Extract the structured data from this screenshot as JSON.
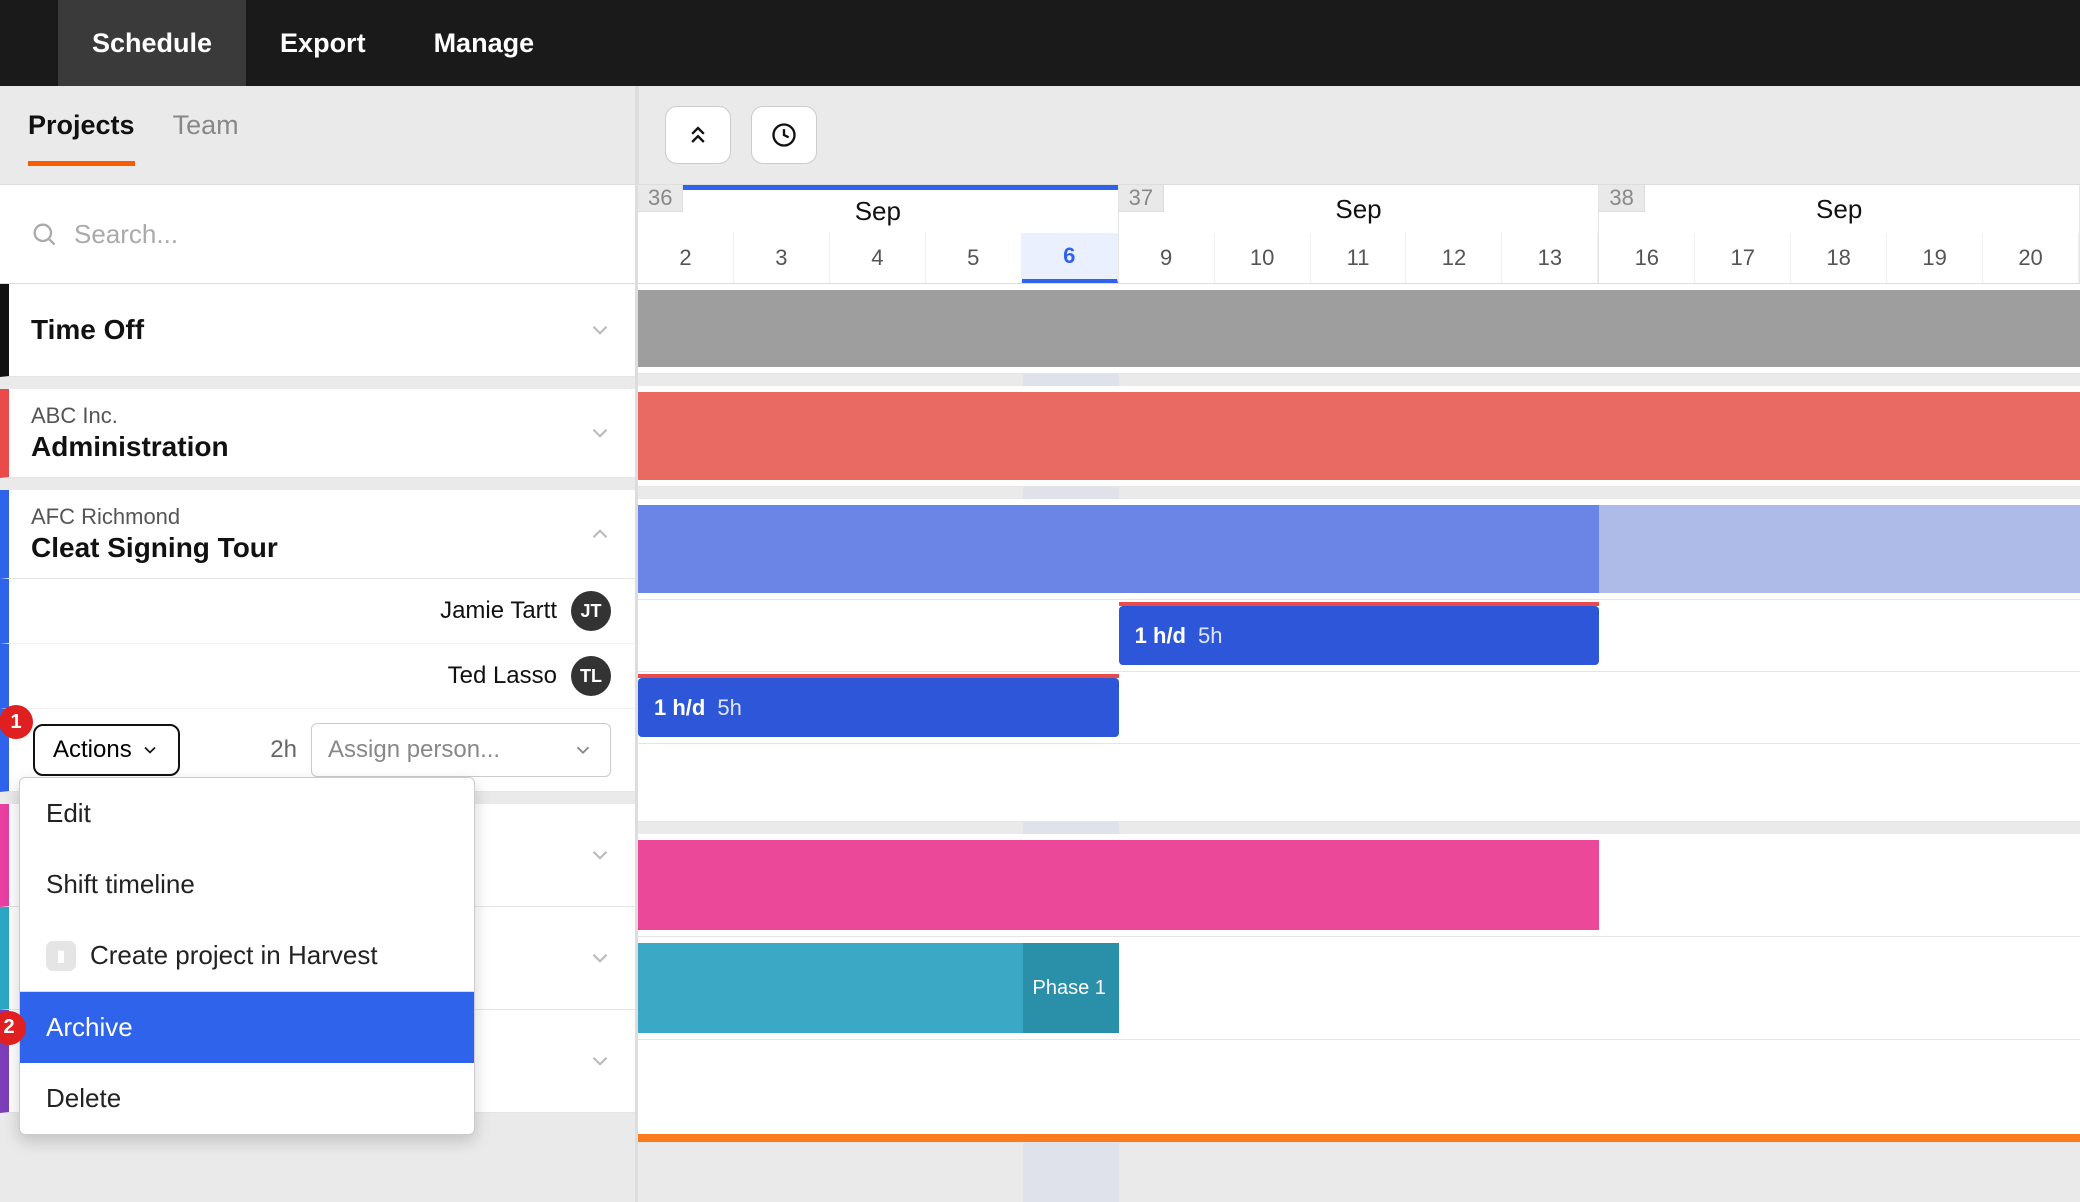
{
  "nav": {
    "tabs": [
      "Schedule",
      "Export",
      "Manage"
    ],
    "active": 0
  },
  "side": {
    "tabs": [
      "Projects",
      "Team"
    ],
    "active": 0,
    "search_placeholder": "Search..."
  },
  "calendar": {
    "weeks": [
      {
        "num": "36",
        "month": "Sep",
        "days": [
          "2",
          "3",
          "4",
          "5",
          "6"
        ],
        "today_index": 4
      },
      {
        "num": "37",
        "month": "Sep",
        "days": [
          "9",
          "10",
          "11",
          "12",
          "13"
        ]
      },
      {
        "num": "38",
        "month": "Sep",
        "days": [
          "16",
          "17",
          "18",
          "19",
          "20"
        ]
      }
    ]
  },
  "projects": [
    {
      "name": "Time Off",
      "client": "",
      "color": "#111",
      "bar_color": "#9e9e9e",
      "bar_start": 0,
      "bar_span": 15
    },
    {
      "name": "Administration",
      "client": "ABC Inc.",
      "color": "#e94b4b",
      "bar_color": "#e86a63",
      "bar_start": 0,
      "bar_span": 15
    },
    {
      "name": "Cleat Signing Tour",
      "client": "AFC Richmond",
      "color": "#2f63eb",
      "expanded": true,
      "bars": [
        {
          "color": "#6b85e6",
          "start": 0,
          "span": 10
        },
        {
          "color": "#aebae8",
          "start": 10,
          "span": 5
        }
      ],
      "people": [
        {
          "name": "Jamie Tartt",
          "initials": "JT",
          "alloc": {
            "start": 5,
            "span": 5,
            "label": "1 h/d",
            "total": "5h",
            "color": "#2e56d8"
          }
        },
        {
          "name": "Ted Lasso",
          "initials": "TL",
          "alloc": {
            "start": 0,
            "span": 5,
            "label": "1 h/d",
            "total": "5h",
            "color": "#2e56d8"
          }
        }
      ],
      "actions": {
        "button": "Actions",
        "hours": "2h",
        "assign_placeholder": "Assign person...",
        "menu": [
          "Edit",
          "Shift timeline",
          "Create project in Harvest",
          "Archive",
          "Delete"
        ],
        "selected": 3
      }
    },
    {
      "name": "",
      "client": "",
      "color": "#e83fa0",
      "bar_color": "#ec4899",
      "bar_start": 0,
      "bar_span": 10,
      "hidden_by_menu": true
    },
    {
      "name": "",
      "client": "",
      "color": "#2ba7c4",
      "bar_color": "#3ba9c6",
      "bar_start": 0,
      "bar_span": 5,
      "phase": {
        "label": "Phase 1",
        "start": 4,
        "span": 1,
        "color": "#2a8fa8"
      },
      "hidden_by_menu": true
    },
    {
      "name": "",
      "client": "",
      "color": "#7b3eb8",
      "bar_color": "#fa7a1e",
      "bar_start": 0,
      "bar_span": 15,
      "thin": true,
      "hidden_by_menu": true
    }
  ],
  "annotations": {
    "a1": "1",
    "a2": "2"
  }
}
